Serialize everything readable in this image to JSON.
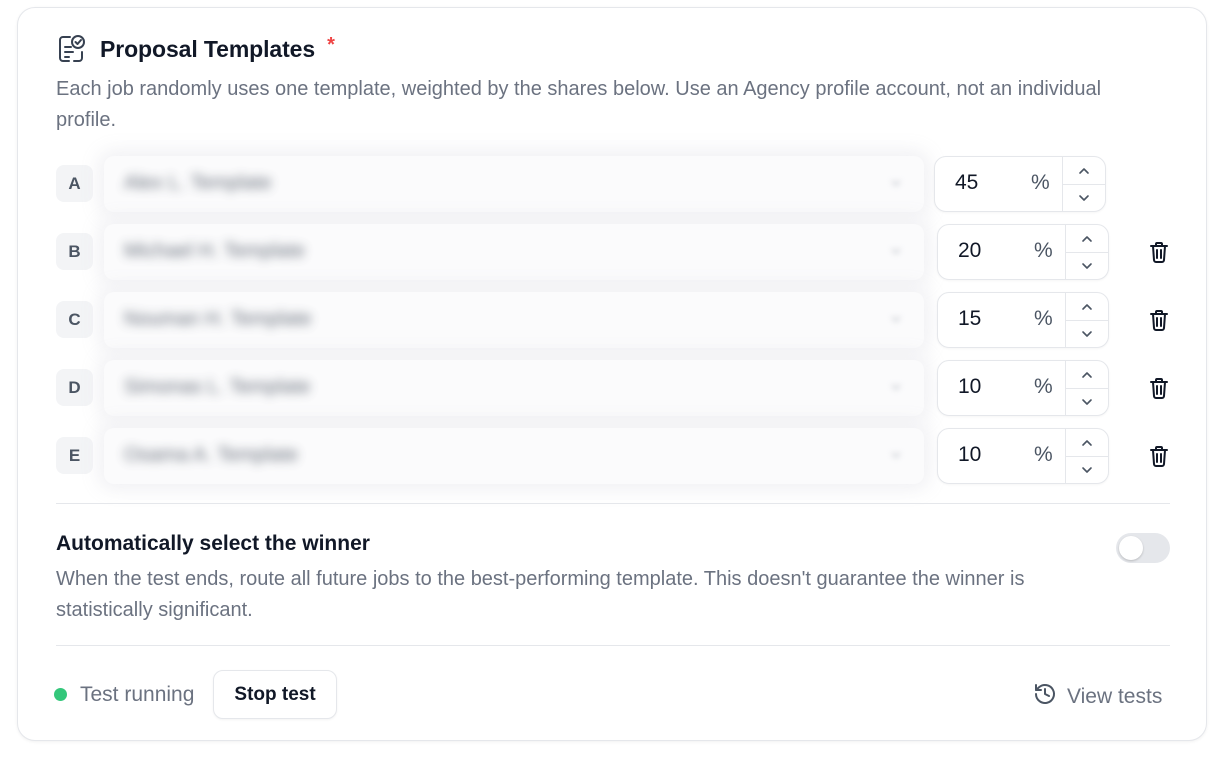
{
  "header": {
    "icon": "template-check-icon",
    "title": "Proposal Templates",
    "required_mark": "*"
  },
  "description": "Each job randomly uses one template, weighted by the shares below. Use an Agency profile account, not an individual profile.",
  "templates": [
    {
      "letter": "A",
      "name": "Alex L. Template",
      "share": "45",
      "unit": "%",
      "deletable": false
    },
    {
      "letter": "B",
      "name": "Michael H. Template",
      "share": "20",
      "unit": "%",
      "deletable": true
    },
    {
      "letter": "C",
      "name": "Nouman H. Template",
      "share": "15",
      "unit": "%",
      "deletable": true
    },
    {
      "letter": "D",
      "name": "Simonas L. Template",
      "share": "10",
      "unit": "%",
      "deletable": true
    },
    {
      "letter": "E",
      "name": "Osama A. Template",
      "share": "10",
      "unit": "%",
      "deletable": true
    }
  ],
  "auto_winner": {
    "title": "Automatically select the winner",
    "description": "When the test ends, route all future jobs to the best-performing template. This doesn't guarantee the winner is statistically significant.",
    "enabled": false
  },
  "footer": {
    "status_text": "Test running",
    "status_color": "#34c77b",
    "stop_label": "Stop test",
    "view_tests_label": "View tests"
  },
  "colors": {
    "required": "#ef4444",
    "muted_text": "#6b7280"
  }
}
